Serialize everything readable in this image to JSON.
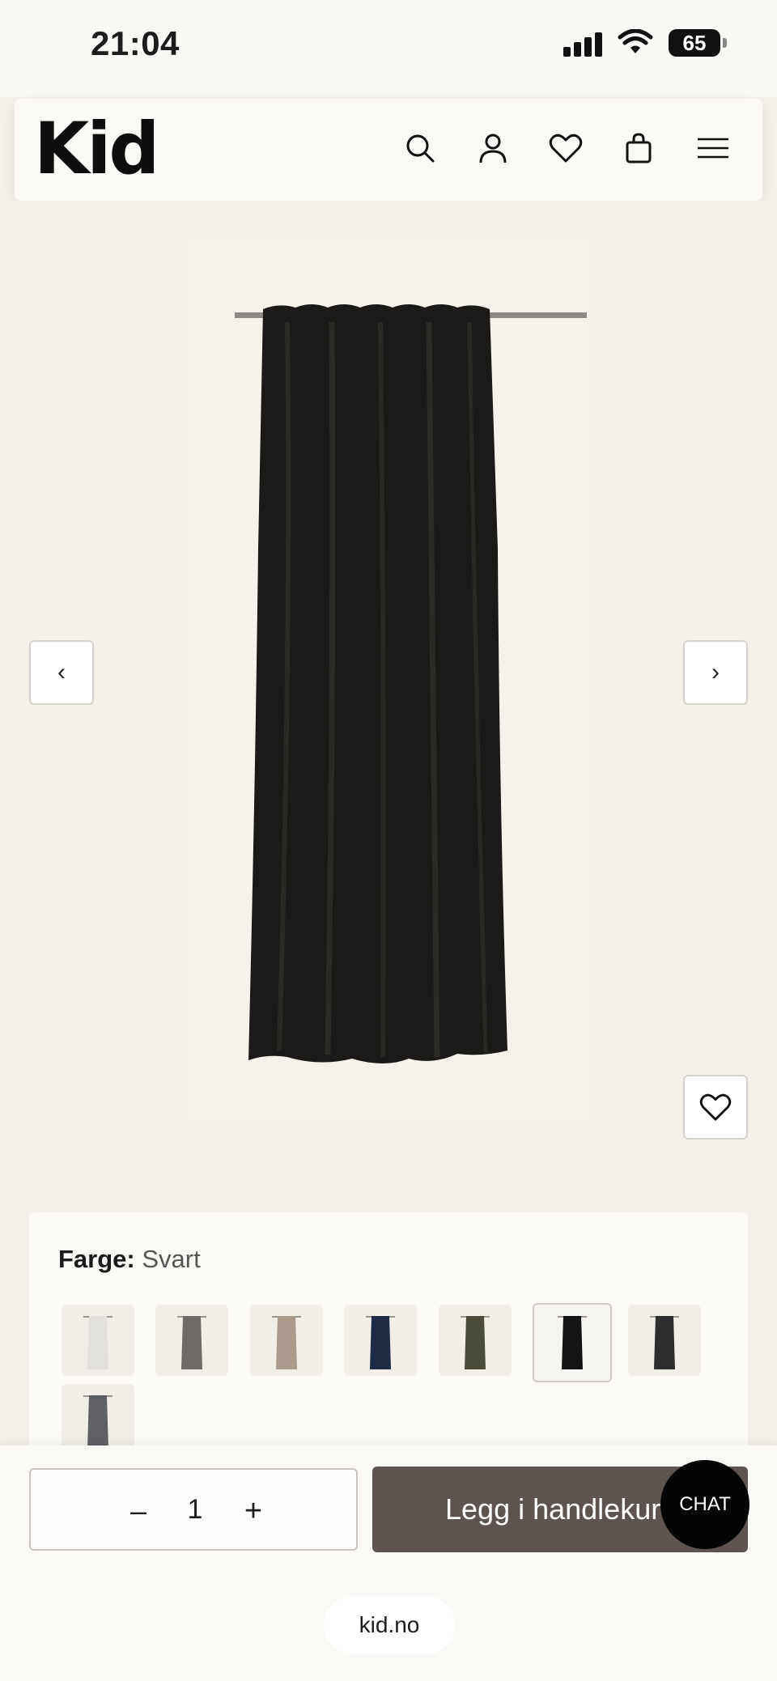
{
  "status_bar": {
    "time": "21:04",
    "battery": "65"
  },
  "header": {
    "logo": "Kid",
    "icons": [
      "search-icon",
      "user-icon",
      "heart-icon",
      "bag-icon",
      "menu-icon"
    ]
  },
  "gallery": {
    "prev_symbol": "‹",
    "next_symbol": "›",
    "product_colors": {
      "curtain": "#1b1a18",
      "rod": "#8e8b86",
      "background": "#f4f1ea"
    }
  },
  "color_selector": {
    "label": "Farge:",
    "value": "Svart",
    "swatch_colors": [
      "#e2e0dc",
      "#6f6a65",
      "#a99a8c",
      "#1f2a44",
      "#4a4b3a",
      "#141414",
      "#2e2e2e",
      "#5f6064"
    ],
    "selected_index": 5
  },
  "purchase": {
    "minus": "–",
    "quantity": "1",
    "plus": "+",
    "add_to_cart": "Legg i handlekurv",
    "chat": "CHAT"
  },
  "browser": {
    "domain": "kid.no"
  }
}
